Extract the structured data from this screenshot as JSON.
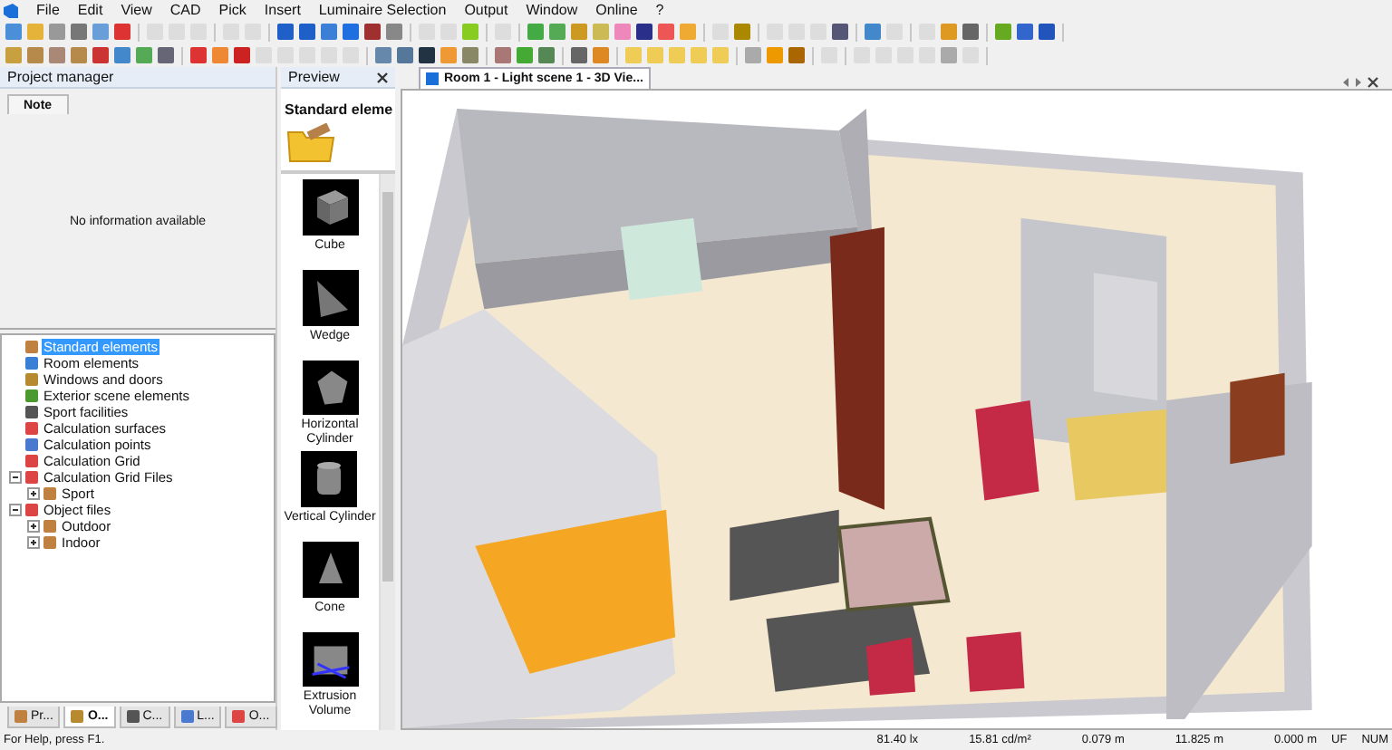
{
  "menu": [
    "File",
    "Edit",
    "View",
    "CAD",
    "Pick",
    "Insert",
    "Luminaire Selection",
    "Output",
    "Window",
    "Online",
    "?"
  ],
  "project_manager": {
    "title": "Project manager",
    "tabs": [
      {
        "label": "Note",
        "selected": true
      }
    ],
    "note": "No information available",
    "tree": [
      {
        "label": "Standard elements",
        "selected": true
      },
      {
        "label": "Room elements",
        "selected": false
      },
      {
        "label": "Windows and doors",
        "selected": false
      },
      {
        "label": "Exterior scene elements",
        "selected": false
      },
      {
        "label": "Sport facilities",
        "selected": false
      },
      {
        "label": "Calculation surfaces",
        "selected": false
      },
      {
        "label": "Calculation points",
        "selected": false
      },
      {
        "label": "Calculation Grid",
        "selected": false
      },
      {
        "label": "Calculation Grid Files",
        "selected": false,
        "expanded": true,
        "children": [
          {
            "label": "Sport",
            "selected": false,
            "expanded": false
          }
        ]
      },
      {
        "label": "Object files",
        "selected": false,
        "expanded": true,
        "children": [
          {
            "label": "Outdoor",
            "selected": false,
            "expanded": false
          },
          {
            "label": "Indoor",
            "selected": false,
            "expanded": false
          }
        ]
      }
    ],
    "bottom_tabs": [
      {
        "label": "Pr...",
        "selected": false
      },
      {
        "label": "O...",
        "selected": true
      },
      {
        "label": "C...",
        "selected": false
      },
      {
        "label": "L...",
        "selected": false
      },
      {
        "label": "O...",
        "selected": false
      }
    ]
  },
  "preview": {
    "title": "Preview",
    "heading": "Standard eleme",
    "items": [
      {
        "label": "Cube",
        "kind": "cube"
      },
      {
        "label": "Wedge",
        "kind": "wedge"
      },
      {
        "label": "Horizontal Cylinder",
        "kind": "hcylinder"
      },
      {
        "label": "Vertical Cylinder",
        "kind": "vcylinder"
      },
      {
        "label": "Cone",
        "kind": "cone"
      },
      {
        "label": "Extrusion Volume",
        "kind": "extrusion"
      }
    ]
  },
  "view": {
    "tab": "Room 1 - Light scene 1 - 3D Vie..."
  },
  "status_bar": {
    "help": "For Help, press F1.",
    "fields": [
      "81.40 lx",
      "15.81 cd/m²",
      "0.079 m",
      "11.825 m",
      "0.000 m",
      "UF",
      "NUM"
    ]
  }
}
